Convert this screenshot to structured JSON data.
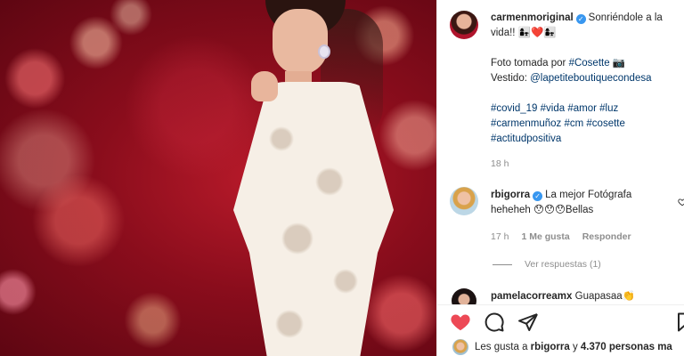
{
  "post": {
    "author": {
      "username": "carmenmoriginal",
      "verified": true
    },
    "caption": {
      "line1": "Sonriéndole a la",
      "line2": "vida!! 👩‍👧❤️👩‍👧",
      "photo_credit_prefix": "Foto tomada por ",
      "photo_credit_tag": "#Cosette",
      "photo_credit_suffix": " 📷",
      "dress_prefix": "Vestido: ",
      "dress_mention": "@lapetiteboutiquecondesa",
      "tags_line1": [
        "#covid_19",
        "#vida",
        "#amor",
        "#luz"
      ],
      "tags_line2": [
        "#carmenmuñoz",
        "#cm",
        "#cosette"
      ],
      "tags_line3": [
        "#actitudpositiva"
      ]
    },
    "time_ago": "18 h",
    "accent_color": "#00376b",
    "like_color": "#ed4956",
    "verified_color": "#3897f0"
  },
  "comments": [
    {
      "username": "rbigorra",
      "verified": true,
      "text_line1": "La mejor Fotógrafa",
      "text_line2": "heheheh 😯😯😯Bellas",
      "time_ago": "17 h",
      "likes": "1 Me gusta",
      "reply_label": "Responder",
      "view_replies": "Ver respuestas (1)"
    },
    {
      "username": "pamelacorreamx",
      "text": "Guapasaa👏"
    }
  ],
  "likes_summary": {
    "prefix": "Les gusta a ",
    "user": "rbigorra",
    "middle": " y ",
    "count": "4.370 personas ma"
  },
  "icons": {
    "like": "heart-icon",
    "comment": "comment-icon",
    "share": "share-icon",
    "save": "bookmark-icon"
  }
}
